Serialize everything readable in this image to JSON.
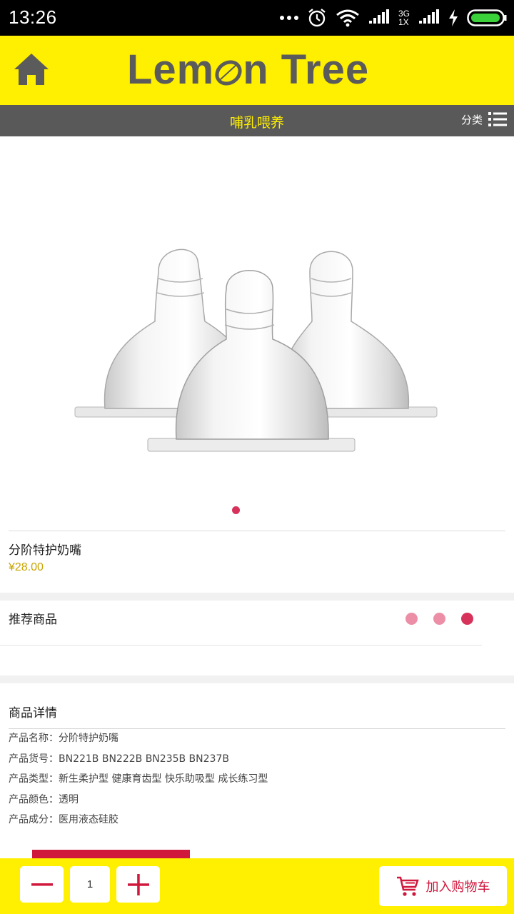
{
  "status_bar": {
    "time": "13:26",
    "network_top": "3G",
    "network_bottom": "1X",
    "icons": [
      "more-dots-icon",
      "alarm-icon",
      "wifi-icon",
      "signal-icon",
      "charging-icon",
      "battery-icon"
    ]
  },
  "header": {
    "logo_text_left": "Lem",
    "logo_text_right": "n Tree",
    "home_icon": "home-icon"
  },
  "category_bar": {
    "title": "哺乳喂养",
    "menu_label": "分类",
    "menu_icon": "list-icon"
  },
  "product": {
    "name": "分阶特护奶嘴",
    "price": "¥28.00",
    "gallery_count": 1,
    "gallery_active": 0
  },
  "recommended": {
    "title": "推荐商品",
    "page_count": 3,
    "active_page": 2
  },
  "details": {
    "title": "商品详情",
    "rows": [
      "产品名称：分阶特护奶嘴",
      "产品货号：BN221B BN222B BN235B BN237B",
      "产品类型：新生柔护型 健康育齿型 快乐助吸型 成长练习型",
      "产品颜色：透明",
      "产品成分：医用液态硅胶"
    ]
  },
  "bottom_bar": {
    "quantity": "1",
    "add_to_cart_label": "加入购物车",
    "cart_icon": "cart-icon"
  },
  "colors": {
    "brand_yellow": "#ffef00",
    "bar_gray": "#595959",
    "accent_red": "#d0173c",
    "price_gold": "#c8a400",
    "dot_pink": "#ec8fa6",
    "dot_active": "#d7325a"
  }
}
